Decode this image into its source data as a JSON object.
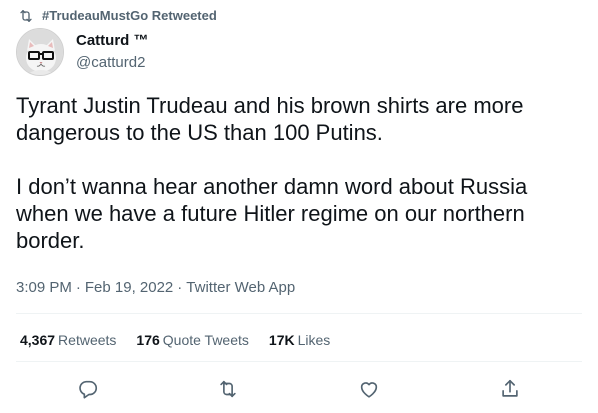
{
  "context": {
    "icon": "retweet-icon",
    "text": "#TrudeauMustGo Retweeted"
  },
  "author": {
    "avatar_icon": "cat-with-glasses-avatar",
    "display_name": "Catturd ™",
    "handle": "@catturd2"
  },
  "tweet": {
    "paragraphs": [
      "Tyrant Justin Trudeau and his brown shirts are more dangerous to the US than 100 Putins.",
      "I don’t wanna hear another damn word about Russia when we have a future Hitler regime on our northern border."
    ]
  },
  "meta": {
    "time": "3:09 PM",
    "separator": "·",
    "date": "Feb 19, 2022",
    "source": "Twitter Web App"
  },
  "stats": {
    "retweets": {
      "count": "4,367",
      "label": "Retweets"
    },
    "quotes": {
      "count": "176",
      "label": "Quote Tweets"
    },
    "likes": {
      "count": "17K",
      "label": "Likes"
    }
  },
  "actions": {
    "reply_icon": "reply-icon",
    "retweet_icon": "retweet-icon",
    "like_icon": "heart-icon",
    "share_icon": "share-icon"
  },
  "colors": {
    "text": "#0f1419",
    "secondary": "#536471",
    "divider": "#eff3f4"
  }
}
